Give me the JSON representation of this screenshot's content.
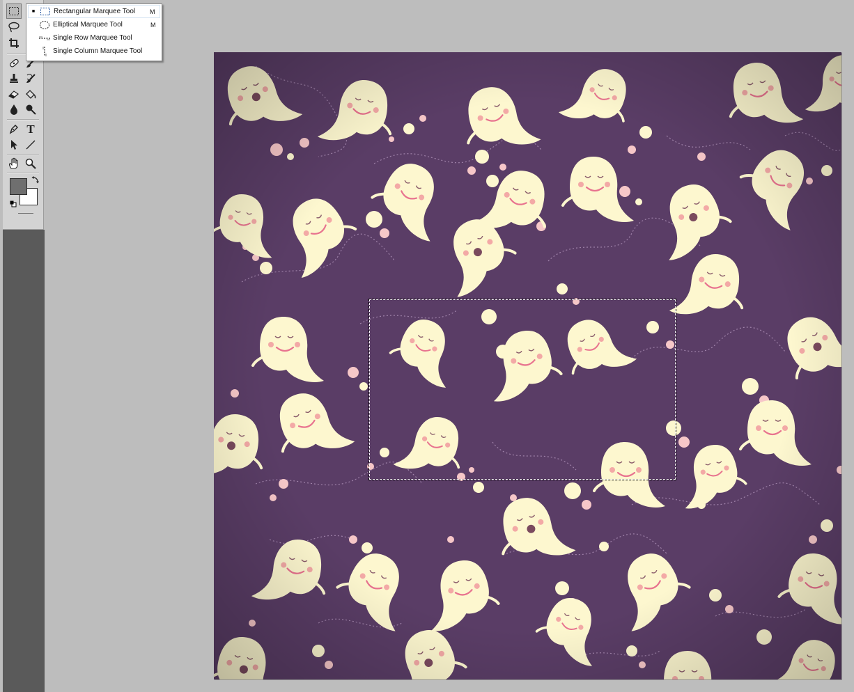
{
  "toolbox": {
    "tools": [
      {
        "name": "rectangular-marquee-tool",
        "icon": "marquee-icon",
        "active": true
      },
      {
        "name": "lasso-tool",
        "icon": "lasso-icon"
      },
      {
        "name": "magic-wand-tool",
        "icon": "magic-wand-icon"
      },
      {
        "name": "crop-tool",
        "icon": "crop-icon"
      },
      {
        "name": "slice-tool",
        "icon": "slice-icon"
      },
      {
        "name": "healing-brush-tool",
        "icon": "bandage-icon"
      },
      {
        "name": "brush-tool",
        "icon": "brush-icon"
      },
      {
        "name": "clone-stamp-tool",
        "icon": "stamp-icon"
      },
      {
        "name": "history-brush-tool",
        "icon": "history-brush-icon"
      },
      {
        "name": "eraser-tool",
        "icon": "eraser-icon"
      },
      {
        "name": "paint-bucket-tool",
        "icon": "bucket-icon"
      },
      {
        "name": "blur-tool",
        "icon": "drop-icon"
      },
      {
        "name": "dodge-tool",
        "icon": "dodge-icon"
      },
      {
        "name": "pen-tool",
        "icon": "pen-icon"
      },
      {
        "name": "type-tool",
        "icon": "type-icon",
        "glyph": "T"
      },
      {
        "name": "path-selection-tool",
        "icon": "arrow-icon"
      },
      {
        "name": "line-tool",
        "icon": "line-icon"
      },
      {
        "name": "hand-tool",
        "icon": "hand-icon"
      },
      {
        "name": "zoom-tool",
        "icon": "zoom-icon"
      }
    ],
    "foreground_color": "#6f6f6f",
    "background_color": "#ffffff"
  },
  "flyout_menu": {
    "items": [
      {
        "label": "Rectangular Marquee Tool",
        "shortcut": "M",
        "selected": true,
        "icon": "rect-marquee-icon"
      },
      {
        "label": "Elliptical Marquee Tool",
        "shortcut": "M",
        "selected": false,
        "icon": "ellipse-marquee-icon"
      },
      {
        "label": "Single Row Marquee Tool",
        "shortcut": "",
        "selected": false,
        "icon": "single-row-icon"
      },
      {
        "label": "Single Column Marquee Tool",
        "shortcut": "",
        "selected": false,
        "icon": "single-column-icon"
      }
    ]
  },
  "canvas": {
    "background": "#5a3d66",
    "ghost_color": "#fdf7cf",
    "cheek_color": "#f3a9a6",
    "mouth_color": "#e8738f",
    "dot_color": "#f6c7c8",
    "has_selection": true
  }
}
